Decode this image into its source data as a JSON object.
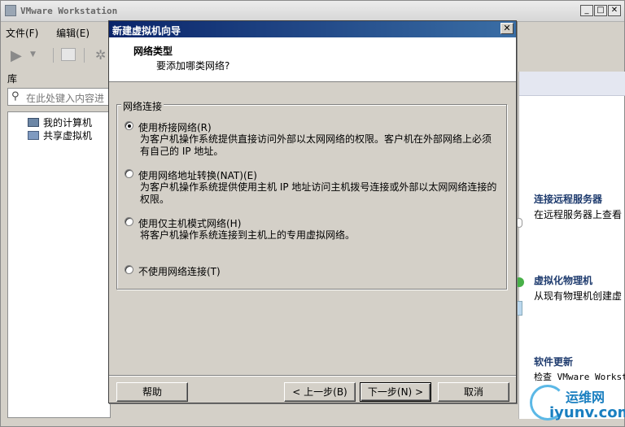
{
  "window": {
    "title": "VMware Workstation",
    "buttons": [
      "_",
      "□",
      "✕"
    ]
  },
  "menu": [
    "文件(F)",
    "编辑(E)"
  ],
  "library": {
    "label": "库",
    "search_placeholder": "在此处键入内容进",
    "items": [
      "我的计算机",
      "共享虚拟机"
    ]
  },
  "home_panel": {
    "items": [
      {
        "title": "连接远程服务器",
        "desc": "在远程服务器上查看"
      },
      {
        "title": "虚拟化物理机",
        "desc": "从现有物理机创建虚"
      },
      {
        "title": "软件更新",
        "desc": "检查 VMware Workst"
      }
    ]
  },
  "dialog": {
    "title": "新建虚拟机向导",
    "close": "✕",
    "header_title": "网络类型",
    "header_subtitle": "要添加哪类网络?",
    "group_label": "网络连接",
    "options": [
      {
        "label": "使用桥接网络(R)",
        "desc": "为客户机操作系统提供直接访问外部以太网网络的权限。客户机在外部网络上必须有自己的 IP 地址。",
        "selected": true
      },
      {
        "label": "使用网络地址转换(NAT)(E)",
        "desc": "为客户机操作系统提供使用主机 IP 地址访问主机拨号连接或外部以太网网络连接的权限。",
        "selected": false
      },
      {
        "label": "使用仅主机模式网络(H)",
        "desc": "将客户机操作系统连接到主机上的专用虚拟网络。",
        "selected": false
      },
      {
        "label": "不使用网络连接(T)",
        "desc": "",
        "selected": false
      }
    ],
    "buttons": {
      "help": "帮助",
      "back": "< 上一步(B)",
      "next": "下一步(N) >",
      "cancel": "取消"
    }
  },
  "watermark": {
    "cn": "运维网",
    "en": "iyunv.com"
  }
}
